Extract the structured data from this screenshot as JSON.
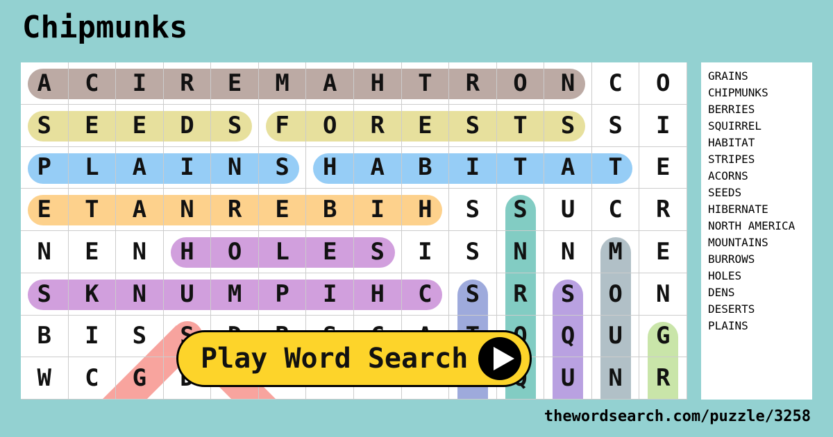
{
  "title": "Chipmunks",
  "grid": [
    "ACIREMAHTRONCO",
    "SEEDSFORESTSSI",
    "PLAINSHABITATE",
    "ETANREBIHSSUCR",
    "NENHOLESISNNME",
    "SKNUMPIHCSRSON",
    "BISSDRSCATOQUG",
    "WCGDESORRSQUNR"
  ],
  "highlights": [
    {
      "r": 0,
      "c0": 0,
      "c1": 11,
      "dir": "h",
      "color": "#b09b94"
    },
    {
      "r": 1,
      "c0": 0,
      "c1": 4,
      "dir": "h",
      "color": "#e3db8c"
    },
    {
      "r": 1,
      "c0": 5,
      "c1": 11,
      "dir": "h",
      "color": "#e3db8c"
    },
    {
      "r": 2,
      "c0": 0,
      "c1": 5,
      "dir": "h",
      "color": "#84c4f5"
    },
    {
      "r": 2,
      "c0": 6,
      "c1": 12,
      "dir": "h",
      "color": "#84c4f5"
    },
    {
      "r": 3,
      "c0": 0,
      "c1": 8,
      "dir": "h",
      "color": "#fdc978"
    },
    {
      "r": 4,
      "c0": 3,
      "c1": 7,
      "dir": "h",
      "color": "#c98ed7"
    },
    {
      "r": 5,
      "c0": 0,
      "c1": 8,
      "dir": "h",
      "color": "#c98ed7"
    },
    {
      "c": 9,
      "r0": 5,
      "r1": 8,
      "dir": "v",
      "color": "#8d9bd6"
    },
    {
      "c": 10,
      "r0": 3,
      "r1": 8,
      "dir": "v",
      "color": "#6cc3b8"
    },
    {
      "c": 11,
      "r0": 5,
      "r1": 8,
      "dir": "v",
      "color": "#ad90dc"
    },
    {
      "c": 12,
      "r0": 4,
      "r1": 8,
      "dir": "v",
      "color": "#a3b5bd"
    },
    {
      "c": 13,
      "r0": 6,
      "r1": 8,
      "dir": "v",
      "color": "#bfe09a"
    }
  ],
  "word_list": [
    "GRAINS",
    "CHIPMUNKS",
    "BERRIES",
    "SQUIRREL",
    "HABITAT",
    "STRIPES",
    "ACORNS",
    "SEEDS",
    "HIBERNATE",
    "NORTH AMERICA",
    "MOUNTAINS",
    "BURROWS",
    "HOLES",
    "DENS",
    "DESERTS",
    "PLAINS"
  ],
  "play_button": "Play Word Search",
  "url": "thewordsearch.com/puzzle/3258"
}
